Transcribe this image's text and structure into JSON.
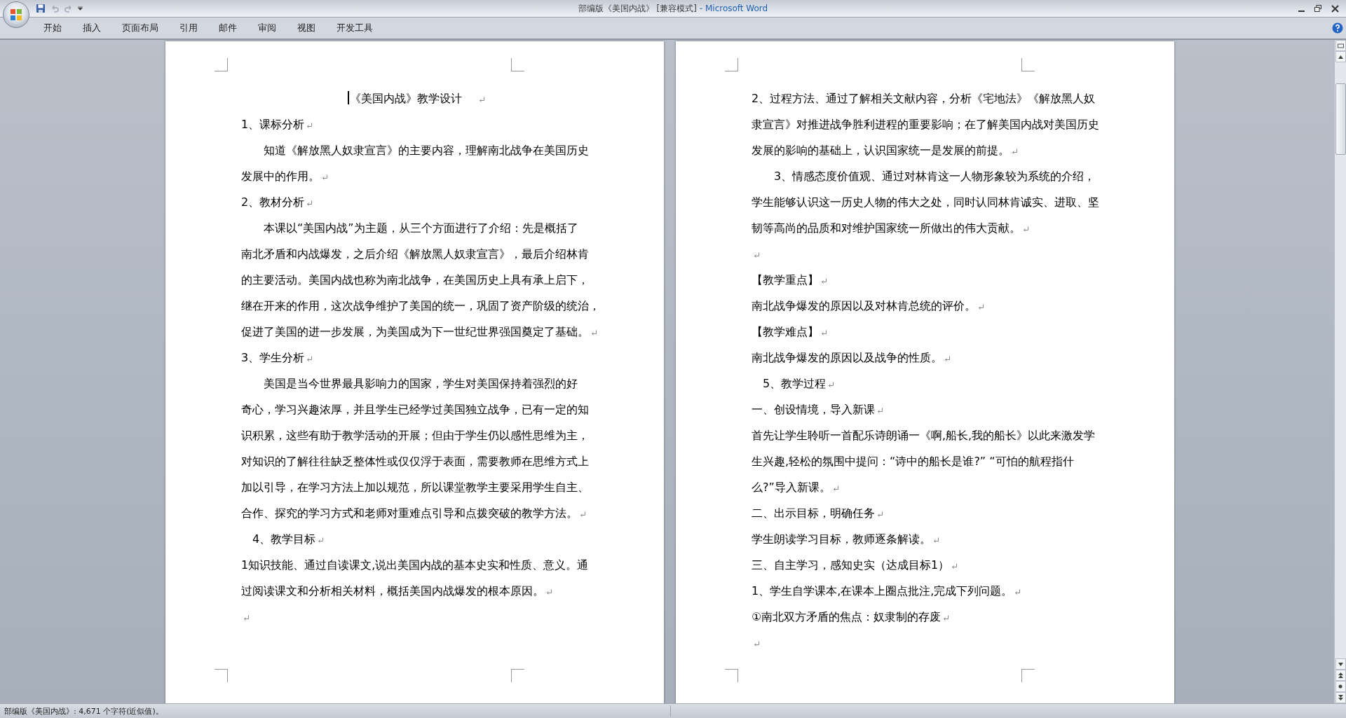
{
  "window": {
    "document_title": "部编版《美国内战》 [兼容模式]",
    "app_name": "- Microsoft Word"
  },
  "quick_access": [
    {
      "kind": "save",
      "disabled": false
    },
    {
      "kind": "undo",
      "disabled": true
    },
    {
      "kind": "redo",
      "disabled": true
    }
  ],
  "ribbon_tabs": [
    {
      "label": "开始"
    },
    {
      "label": "插入"
    },
    {
      "label": "页面布局"
    },
    {
      "label": "引用"
    },
    {
      "label": "邮件"
    },
    {
      "label": "审阅"
    },
    {
      "label": "视图"
    },
    {
      "label": "开发工具"
    }
  ],
  "pages": [
    {
      "paragraphs": [
        {
          "kind": "title",
          "lines": [
            "《美国内战》教学设计"
          ],
          "cursor": true
        },
        {
          "kind": "plain",
          "lines": [
            "1、课标分析"
          ]
        },
        {
          "kind": "indent",
          "lines": [
            "知道《解放黑人奴隶宣言》的主要内容，理解南北战争在美国历史",
            "发展中的作用。"
          ]
        },
        {
          "kind": "plain",
          "lines": [
            "2、教材分析"
          ]
        },
        {
          "kind": "indent",
          "lines": [
            "本课以“美国内战”为主题，从三个方面进行了介绍：先是概括了",
            "南北矛盾和内战爆发，之后介绍《解放黑人奴隶宣言》，最后介绍林肯",
            "的主要活动。美国内战也称为南北战争，在美国历史上具有承上启下，",
            "继在开来的作用，这次战争维护了美国的统一，巩固了资产阶级的统治，",
            "促进了美国的进一步发展，为美国成为下一世纪世界强国奠定了基础。"
          ]
        },
        {
          "kind": "plain",
          "lines": [
            "3、学生分析"
          ]
        },
        {
          "kind": "indent",
          "lines": [
            "美国是当今世界最具影响力的国家，学生对美国保持着强烈的好",
            "奇心，学习兴趣浓厚，并且学生已经学过美国独立战争，已有一定的知",
            "识积累，这些有助于教学活动的开展；但由于学生仍以感性思维为主，",
            "对知识的了解往往缺乏整体性或仅仅浮于表面，需要教师在思维方式上",
            "加以引导，在学习方法上加以规范，所以课堂教学主要采用学生自主、",
            "合作、探究的学习方式和老师对重难点引导和点拨突破的教学方法。"
          ]
        },
        {
          "kind": "indent-small",
          "lines": [
            "4、教学目标"
          ]
        },
        {
          "kind": "plain",
          "lines": [
            "1知识技能、通过自读课文,说出美国内战的基本史实和性质、意义。通",
            "过阅读课文和分析相关材料，概括美国内战爆发的根本原因。"
          ]
        },
        {
          "kind": "empty"
        }
      ]
    },
    {
      "paragraphs": [
        {
          "kind": "plain",
          "lines": [
            "2、过程方法、通过了解相关文献内容，分析《宅地法》《解放黑人奴",
            "隶宣言》对推进战争胜利进程的重要影响；在了解美国内战对美国历史",
            "发展的影响的基础上，认识国家统一是发展的前提。"
          ]
        },
        {
          "kind": "indent",
          "lines": [
            "3、情感态度价值观、通过对林肯这一人物形象较为系统的介绍，",
            "学生能够认识这一历史人物的伟大之处，同时认同林肯诚实、进取、坚",
            "韧等高尚的品质和对维护国家统一所做出的伟大贡献。"
          ]
        },
        {
          "kind": "empty"
        },
        {
          "kind": "plain",
          "lines": [
            "【教学重点】"
          ]
        },
        {
          "kind": "plain",
          "lines": [
            "南北战争爆发的原因以及对林肯总统的评价。"
          ]
        },
        {
          "kind": "plain",
          "lines": [
            "【教学难点】"
          ]
        },
        {
          "kind": "plain",
          "lines": [
            "南北战争爆发的原因以及战争的性质。"
          ]
        },
        {
          "kind": "indent-small",
          "lines": [
            "5、教学过程"
          ]
        },
        {
          "kind": "plain",
          "lines": [
            "一、创设情境，导入新课"
          ]
        },
        {
          "kind": "plain",
          "lines": [
            "首先让学生聆听一首配乐诗朗诵一《啊,船长,我的船长》以此来激发学",
            "生兴趣,轻松的氛围中提问：“诗中的船长是谁?” “可怕的航程指什",
            "么?”导入新课。"
          ]
        },
        {
          "kind": "plain",
          "lines": [
            "二、出示目标，明确任务"
          ]
        },
        {
          "kind": "plain",
          "lines": [
            "学生朗读学习目标，教师逐条解读。"
          ]
        },
        {
          "kind": "plain",
          "lines": [
            "三、自主学习，感知史实（达成目标1）"
          ]
        },
        {
          "kind": "plain",
          "lines": [
            "1、学生自学课本,在课本上圈点批注,完成下列问题。"
          ]
        },
        {
          "kind": "plain",
          "lines": [
            "①南北双方矛盾的焦点：奴隶制的存废"
          ]
        },
        {
          "kind": "empty"
        }
      ]
    }
  ],
  "status_bar": {
    "text": "部编版《美国内战》: 4,671 个字符(近似值)。"
  }
}
